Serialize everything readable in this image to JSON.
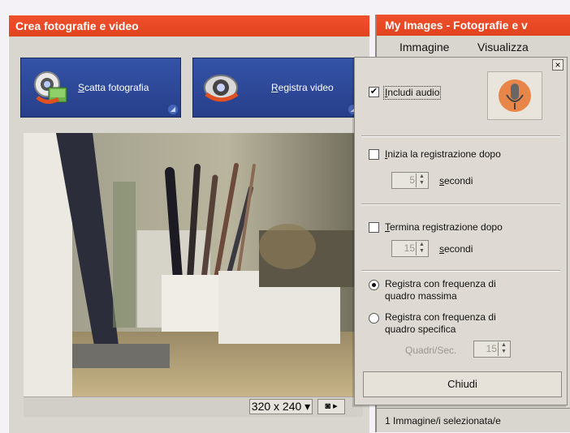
{
  "left_window": {
    "title": "Crea fotografie e video",
    "buttons": [
      {
        "label_underlined": "S",
        "label_rest": "catta fotografia",
        "icon": "webcam-photo-icon"
      },
      {
        "label_underlined": "R",
        "label_rest": "egistra video",
        "icon": "webcam-video-icon"
      }
    ],
    "preview_bar": {
      "resolution": "320 x 240",
      "dropdown_arrow": "▾",
      "camera_menu": "▸"
    }
  },
  "right_window": {
    "title": "My Images - Fotografie e v",
    "menu": [
      "Immagine",
      "Visualizza"
    ],
    "status": "1 Immagine/i selezionata/e"
  },
  "popup": {
    "close": "×",
    "audio": {
      "label_underlined": "I",
      "label_rest": "ncludi audio",
      "checked": true,
      "icon": "microphone-icon"
    },
    "start_delay": {
      "label_underlined": "I",
      "label_rest": "nizia la registrazione dopo",
      "checked": false,
      "value": "5",
      "unit_underlined": "s",
      "unit_rest": "econdi"
    },
    "end_delay": {
      "label_underlined": "T",
      "label_rest": "ermina registrazione dopo",
      "checked": false,
      "value": "15",
      "unit_underlined": "s",
      "unit_rest": "econdi"
    },
    "frame_rate": {
      "options": [
        {
          "line1": "Registra con frequenza di",
          "line2": "quadro massima",
          "selected": true
        },
        {
          "line1": "Registra con frequenza di",
          "line2": "quadro specifica",
          "selected": false
        }
      ],
      "fps_label": "Quadri/Sec.",
      "fps_value": "15"
    },
    "close_button": "Chiudi"
  }
}
